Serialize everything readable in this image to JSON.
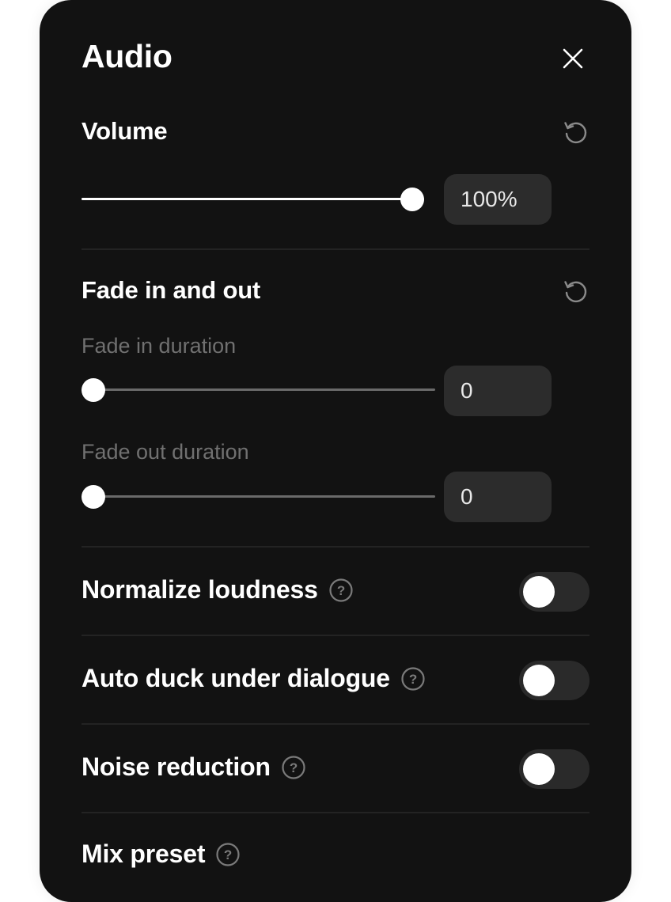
{
  "panel": {
    "title": "Audio",
    "close_icon": "close-icon"
  },
  "volume": {
    "title": "Volume",
    "reset_icon": "reset-icon",
    "value": 1.0,
    "display": "100%"
  },
  "fade": {
    "title": "Fade in and out",
    "reset_icon": "reset-icon",
    "fade_in": {
      "label": "Fade in duration",
      "value": 0,
      "display": "0"
    },
    "fade_out": {
      "label": "Fade out duration",
      "value": 0,
      "display": "0"
    }
  },
  "toggles": [
    {
      "label": "Normalize loudness",
      "help_icon": "help-icon",
      "on": false
    },
    {
      "label": "Auto duck under dialogue",
      "help_icon": "help-icon",
      "on": false
    },
    {
      "label": "Noise reduction",
      "help_icon": "help-icon",
      "on": false
    }
  ],
  "mix_preset": {
    "label": "Mix preset",
    "help_icon": "help-icon"
  },
  "colors": {
    "panel_bg": "#121212",
    "input_bg": "#2c2c2c",
    "toggle_off_bg": "#2a2a2a",
    "muted_text": "#707070",
    "accent": "#ffffff"
  }
}
